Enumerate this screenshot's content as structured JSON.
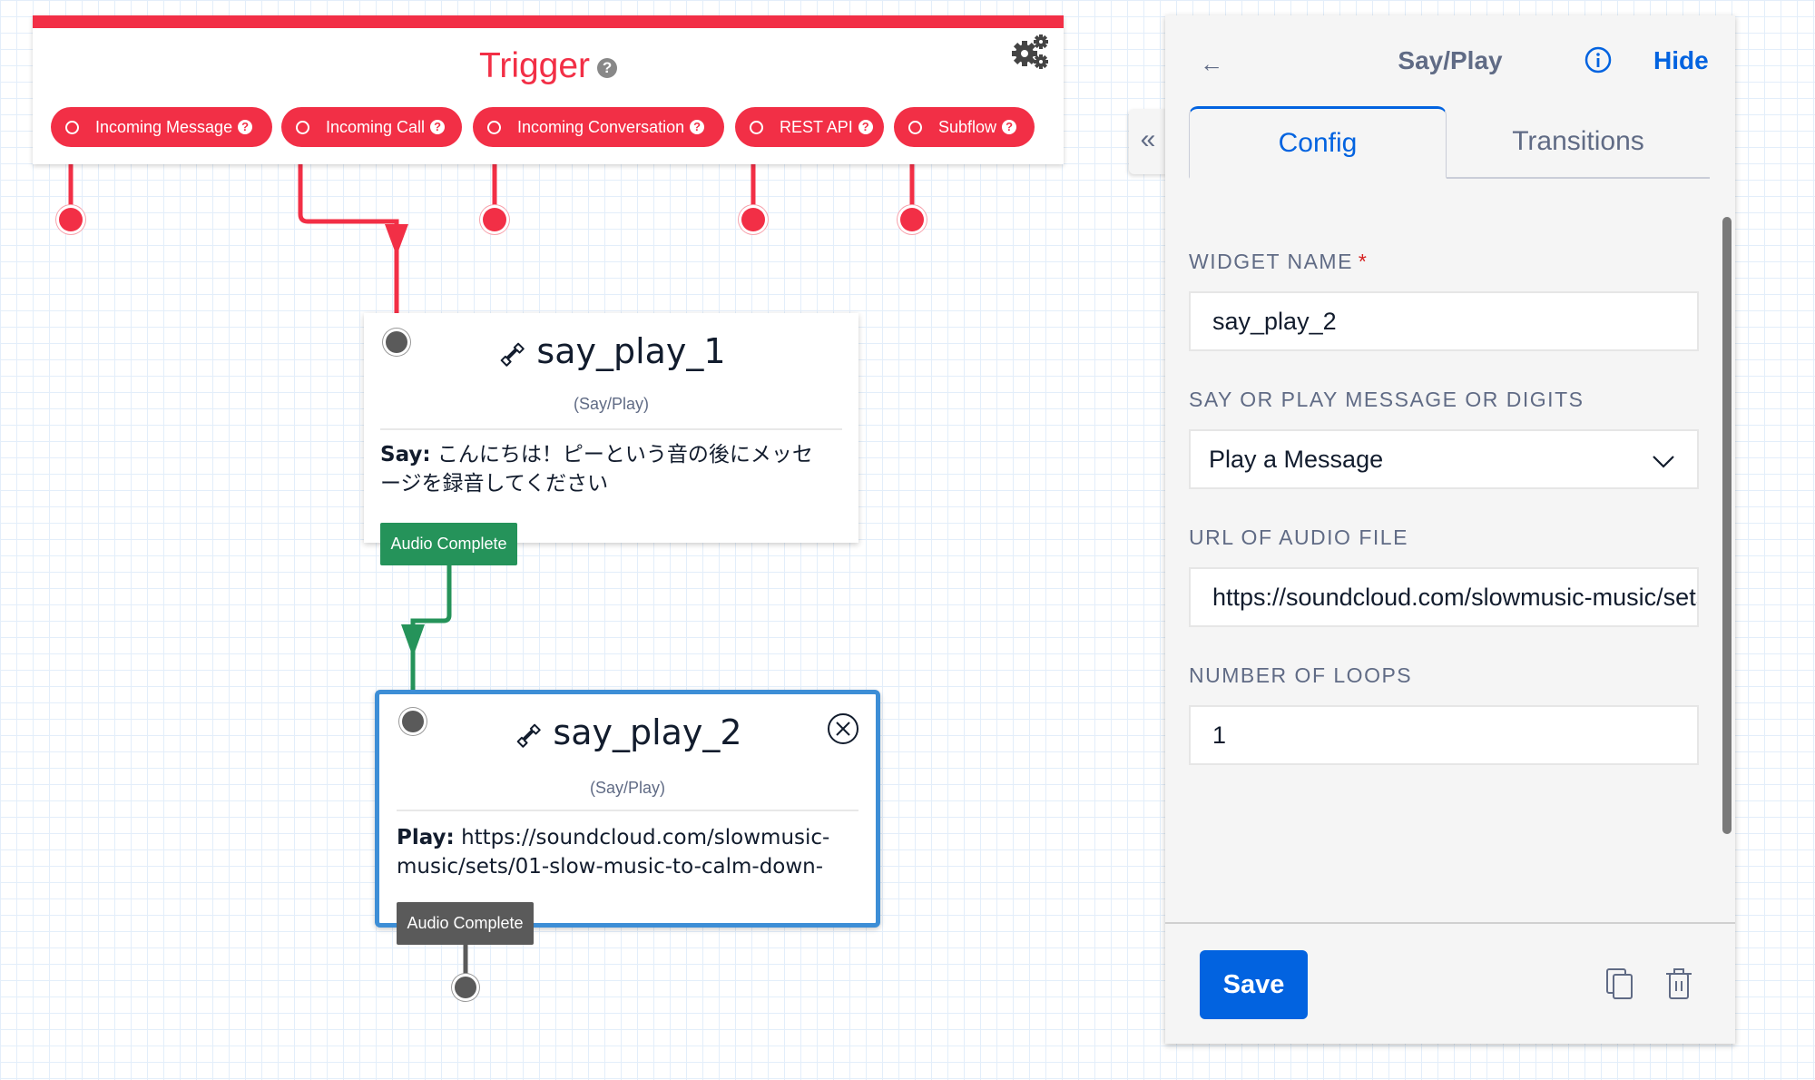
{
  "trigger": {
    "title": "Trigger",
    "help_icon": "question-circle-icon",
    "settings_icon": "gears-icon",
    "triggers": [
      {
        "label": "Incoming Message"
      },
      {
        "label": "Incoming Call"
      },
      {
        "label": "Incoming Conversation"
      },
      {
        "label": "REST API"
      },
      {
        "label": "Subflow"
      }
    ],
    "color": "#f22f46"
  },
  "widgets": [
    {
      "name": "say_play_1",
      "type": "(Say/Play)",
      "body_label": "Say:",
      "body_text": "こんにちは！ピーという音の後にメッセージを録音してください",
      "transition": "Audio Complete",
      "transition_color": "#25935a",
      "selected": false
    },
    {
      "name": "say_play_2",
      "type": "(Say/Play)",
      "body_label": "Play:",
      "body_text": "https://soundcloud.com/slowmusic-music/sets/01-slow-music-to-calm-down-",
      "transition": "Audio Complete",
      "transition_color": "#5a5a5a",
      "selected": true,
      "selected_color": "#3d8ed6"
    }
  ],
  "panel": {
    "back_icon": "arrow-left-icon",
    "title": "Say/Play",
    "info_icon": "info-icon",
    "hide_label": "Hide",
    "collapse_icon": "double-chevron-left-icon",
    "collapse_glyph": "«",
    "tabs": [
      {
        "label": "Config",
        "active": true
      },
      {
        "label": "Transitions",
        "active": false
      }
    ],
    "fields": {
      "widget_name": {
        "label": "WIDGET NAME",
        "required_mark": "*",
        "value": "say_play_2"
      },
      "say_or_play": {
        "label": "SAY OR PLAY MESSAGE OR DIGITS",
        "value": "Play a Message"
      },
      "audio_url": {
        "label": "URL OF AUDIO FILE",
        "value": "https://soundcloud.com/slowmusic-music/sets/01-slow-music-to-calm-down-"
      },
      "loops": {
        "label": "NUMBER OF LOOPS",
        "value": "1"
      }
    },
    "save_label": "Save",
    "duplicate_icon": "copy-icon",
    "delete_icon": "trash-icon",
    "accent": "#0263e0"
  }
}
